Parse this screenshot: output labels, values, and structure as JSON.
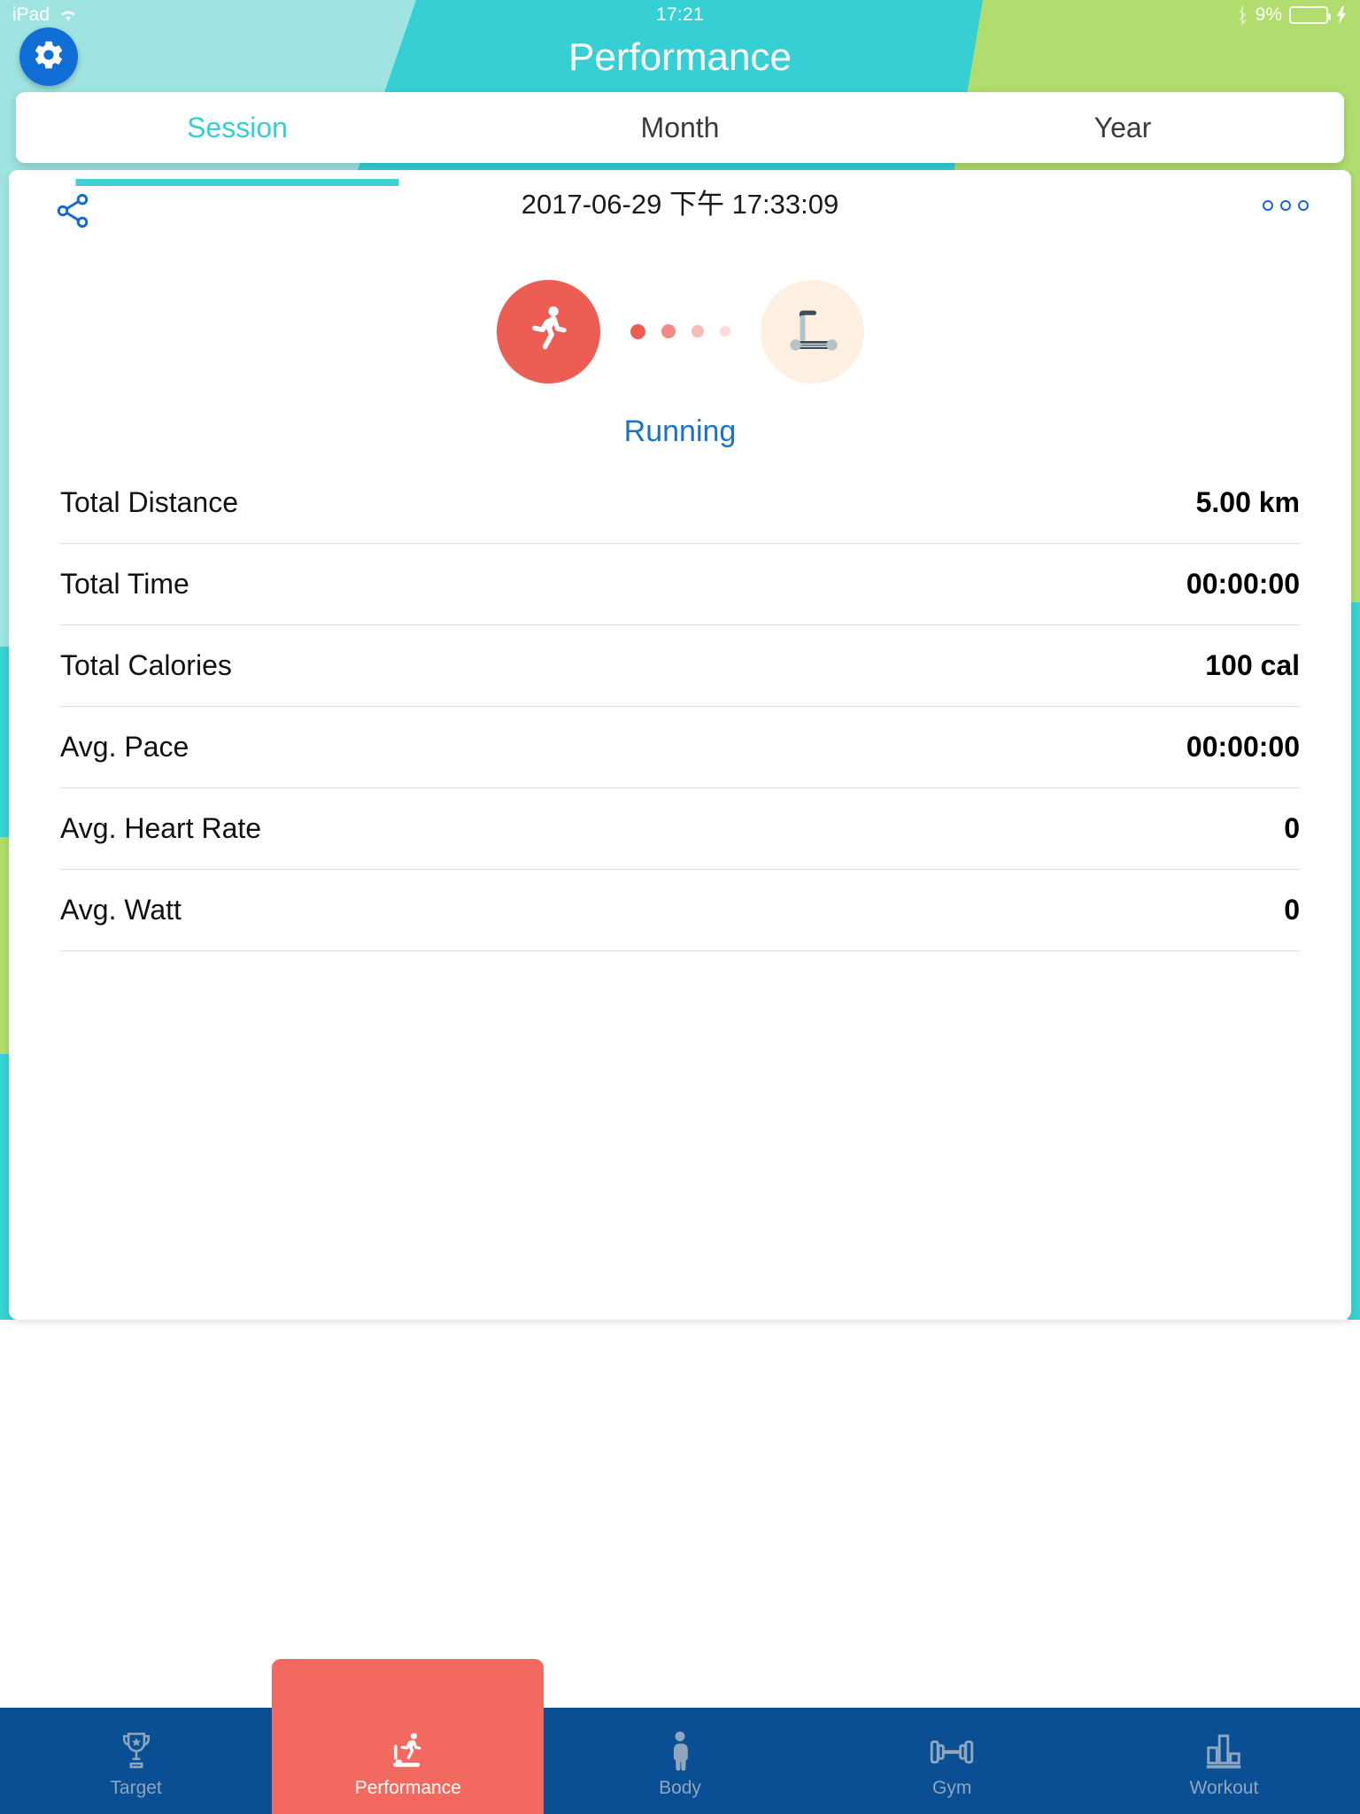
{
  "status_bar": {
    "device": "iPad",
    "wifi_icon": "wifi-icon",
    "time": "17:21",
    "bluetooth_icon": "bluetooth-icon",
    "battery_percent": "9%",
    "battery_level": 9,
    "charging_icon": "lightning-bolt-icon",
    "battery_color": "#f5342a"
  },
  "header": {
    "title": "Performance",
    "settings_icon": "gear-icon",
    "accent_blue": "#106ed6"
  },
  "segment_tabs": {
    "active_index": 0,
    "items": [
      {
        "label": "Session"
      },
      {
        "label": "Month"
      },
      {
        "label": "Year"
      }
    ],
    "active_color": "#35cfd4"
  },
  "session": {
    "share_icon": "share-icon",
    "date": "2017-06-29 下午 17:33:09",
    "more_icon": "more-options-icon",
    "activity_icon": "running-person-icon",
    "equipment_icon": "treadmill-icon",
    "activity_name": "Running",
    "activity_name_color": "#1b72cc",
    "activity_circle_color": "#ec5d53",
    "equipment_circle_color": "#fdf0e0"
  },
  "stats": [
    {
      "label": "Total Distance",
      "value": "5.00 km"
    },
    {
      "label": "Total Time",
      "value": "00:00:00"
    },
    {
      "label": "Total Calories",
      "value": "100 cal"
    },
    {
      "label": "Avg. Pace",
      "value": "00:00:00"
    },
    {
      "label": "Avg. Heart Rate",
      "value": "0"
    },
    {
      "label": "Avg. Watt",
      "value": "0"
    }
  ],
  "bottom_tabs": {
    "active_index": 1,
    "active_color": "#f2695f",
    "bar_color": "#0a4e94",
    "items": [
      {
        "label": "Target",
        "icon": "trophy-icon"
      },
      {
        "label": "Performance",
        "icon": "treadmill-runner-icon"
      },
      {
        "label": "Body",
        "icon": "person-icon"
      },
      {
        "label": "Gym",
        "icon": "dumbbell-icon"
      },
      {
        "label": "Workout",
        "icon": "bar-chart-icon"
      }
    ]
  }
}
